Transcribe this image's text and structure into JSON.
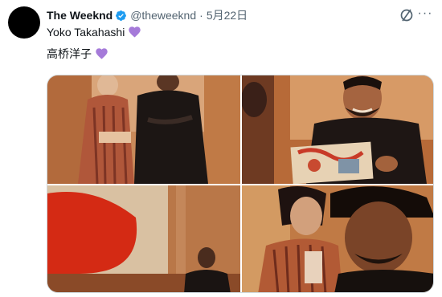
{
  "tweet": {
    "author_name": "The Weeknd",
    "handle": "@theweeknd",
    "separator": "·",
    "date": "5月22日",
    "text_line1": "Yoko Takahashi",
    "text_line2": "高桥洋子",
    "verified_icon": "verified-badge-icon",
    "heart_icon": "purple-heart-emoji",
    "heart_color": "#a57ad9",
    "verified_color": "#1d9bf0",
    "more_label": "···"
  },
  "photos": [
    {
      "name": "photo-1"
    },
    {
      "name": "photo-2"
    },
    {
      "name": "photo-3"
    },
    {
      "name": "photo-4"
    }
  ]
}
